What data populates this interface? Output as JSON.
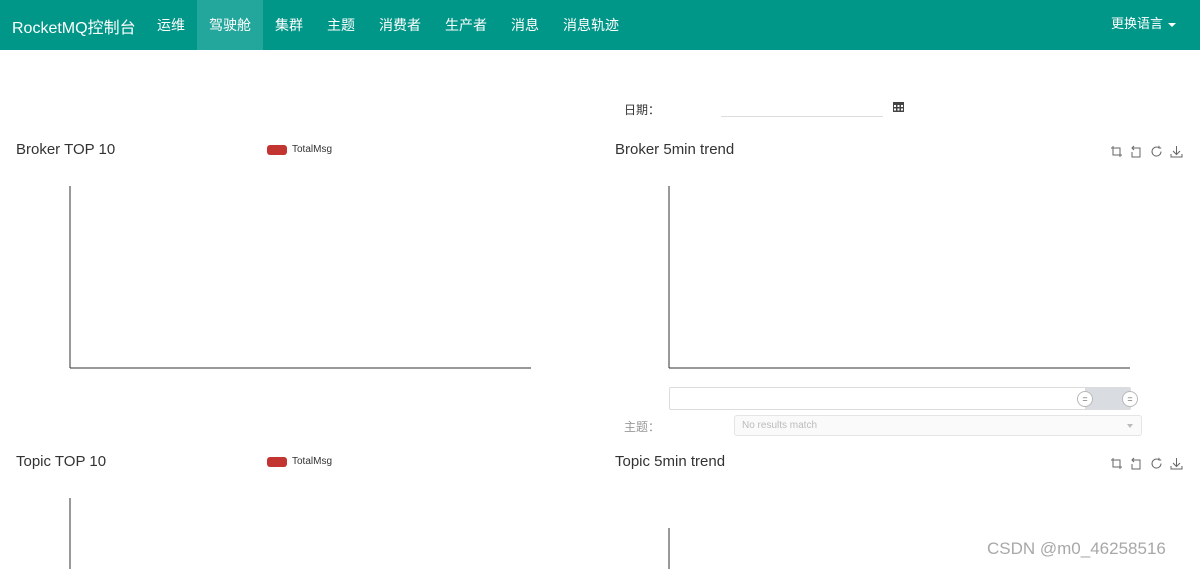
{
  "navbar": {
    "brand": "RocketMQ控制台",
    "items": [
      {
        "label": "运维",
        "active": false
      },
      {
        "label": "驾驶舱",
        "active": true
      },
      {
        "label": "集群",
        "active": false
      },
      {
        "label": "主题",
        "active": false
      },
      {
        "label": "消费者",
        "active": false
      },
      {
        "label": "生产者",
        "active": false
      },
      {
        "label": "消息",
        "active": false
      },
      {
        "label": "消息轨迹",
        "active": false
      }
    ],
    "language": "更换语言",
    "color": "#009688",
    "active_color": "#23a69b"
  },
  "date_filter": {
    "label": "日期：",
    "value": "",
    "icon": "calendar-icon"
  },
  "panels": {
    "broker_top10": {
      "title": "Broker TOP 10",
      "legend": "TotalMsg",
      "legend_color": "#c23531"
    },
    "broker_trend": {
      "title": "Broker 5min trend",
      "tools": [
        "zoom-icon",
        "zoom-reset-icon",
        "restore-icon",
        "download-icon"
      ]
    },
    "topic_top10": {
      "title": "Topic TOP 10",
      "legend": "TotalMsg",
      "legend_color": "#c23531"
    },
    "topic_trend": {
      "title": "Topic 5min trend",
      "tools": [
        "zoom-icon",
        "zoom-reset-icon",
        "restore-icon",
        "download-icon"
      ]
    }
  },
  "data_zoom": {
    "handle_glyph": "="
  },
  "topic_filter": {
    "label": "主题：",
    "placeholder": "No results match"
  },
  "watermark": "CSDN @m0_46258516"
}
